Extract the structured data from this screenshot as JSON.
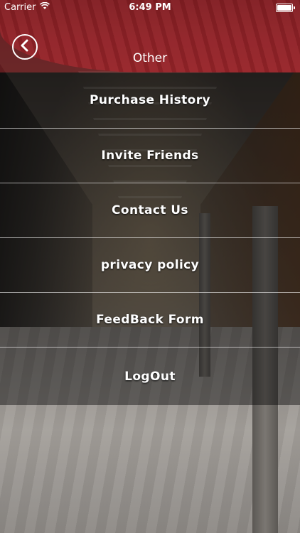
{
  "status_bar": {
    "carrier": "Carrier",
    "time": "6:49 PM"
  },
  "nav": {
    "title": "Other",
    "back_icon": "chevron-left-icon"
  },
  "menu": {
    "items": [
      {
        "label": "Purchase History"
      },
      {
        "label": "Invite Friends"
      },
      {
        "label": "Contact Us"
      },
      {
        "label": "privacy policy"
      },
      {
        "label": "FeedBack Form"
      },
      {
        "label": "LogOut"
      }
    ]
  },
  "colors": {
    "header_tint": "#9b2f33",
    "menu_overlay": "#000000",
    "text": "#ffffff"
  }
}
